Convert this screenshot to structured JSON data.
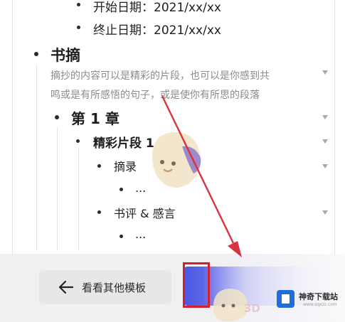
{
  "outline": {
    "start_date": "开始日期：2021/xx/xx",
    "end_date": "终止日期：2021/xx/xx",
    "excerpt_heading": "书摘",
    "excerpt_hint_line1": "摘抄的内容可以是精彩的片段，也可以是你感到共",
    "excerpt_hint_line2": "鸣或是有所感悟的句子，或是使你有所思的段落",
    "chapter": "第 1 章",
    "passage": "精彩片段 1",
    "quote_label": "摘录",
    "quote_value": "...",
    "review_label": "书评 & 感言",
    "review_value": "..."
  },
  "footer": {
    "other_templates_label": "看看其他模板",
    "use_button_label": ""
  },
  "watermark": {
    "site_name": "神奇下载站",
    "site_url": "www.sqxzz.com",
    "mark_3d": "3D"
  },
  "icons": {
    "back": "arrow-left-icon",
    "collapse": "caret-down-icon",
    "site_logo": "site-logo-icon"
  },
  "colors": {
    "accent": "#4a57e0",
    "highlight": "#d41f2e",
    "annotation_arrow": "#d8333f"
  }
}
